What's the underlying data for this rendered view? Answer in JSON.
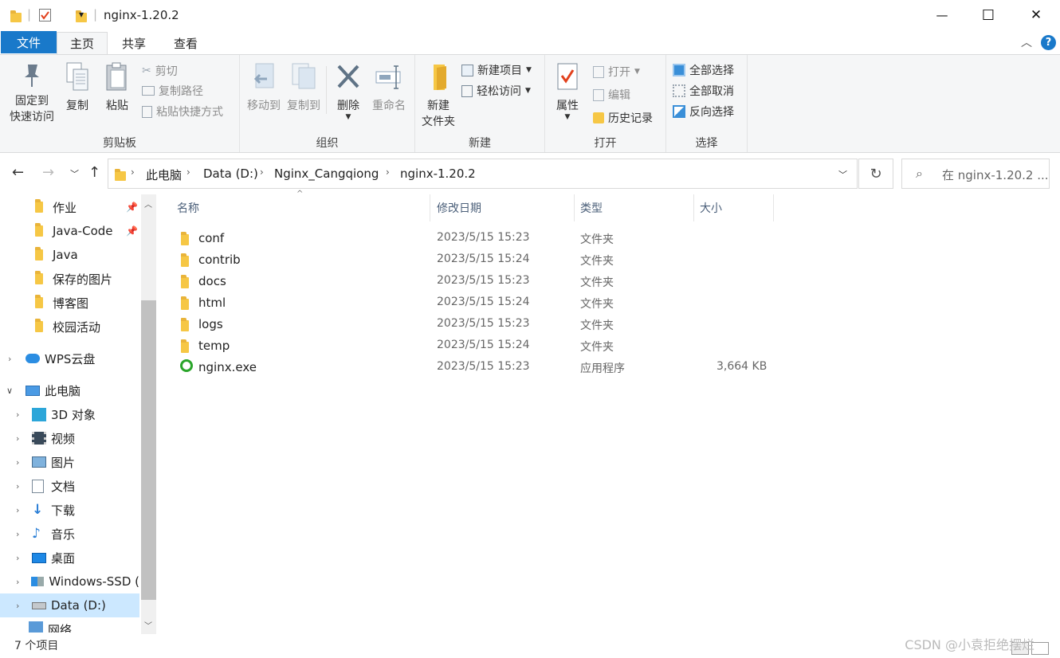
{
  "window": {
    "title": "nginx-1.20.2",
    "minimize": "—",
    "maximize": "☐",
    "close": "✕",
    "qat_dropdown": "▾"
  },
  "tabs": {
    "file": "文件",
    "home": "主页",
    "share": "共享",
    "view": "查看",
    "collapse": "︿",
    "help": "?"
  },
  "ribbon": {
    "clipboard": {
      "label": "剪贴板",
      "pin_quick": "固定到\n快速访问",
      "copy": "复制",
      "paste": "粘贴",
      "cut": "剪切",
      "copy_path": "复制路径",
      "paste_shortcut": "粘贴快捷方式"
    },
    "organize": {
      "label": "组织",
      "move_to": "移动到",
      "copy_to": "复制到",
      "delete": "删除",
      "rename": "重命名"
    },
    "new": {
      "label": "新建",
      "new_folder": "新建\n文件夹",
      "new_item": "新建项目",
      "easy_access": "轻松访问"
    },
    "open": {
      "label": "打开",
      "properties": "属性",
      "open": "打开",
      "edit": "编辑",
      "history": "历史记录"
    },
    "select": {
      "label": "选择",
      "select_all": "全部选择",
      "select_none": "全部取消",
      "invert": "反向选择"
    }
  },
  "address": {
    "crumbs": [
      "此电脑",
      "Data (D:)",
      "Nginx_Cangqiong",
      "nginx-1.20.2"
    ],
    "search_placeholder": "在 nginx-1.20.2 ..."
  },
  "nav": {
    "quick": [
      {
        "label": "作业",
        "pinned": true
      },
      {
        "label": "Java-Code",
        "pinned": true
      },
      {
        "label": "Java",
        "pinned": false
      },
      {
        "label": "保存的图片",
        "pinned": false
      },
      {
        "label": "博客图",
        "pinned": false
      },
      {
        "label": "校园活动",
        "pinned": false
      }
    ],
    "wps": "WPS云盘",
    "pc": "此电脑",
    "pc_items": [
      "3D 对象",
      "视频",
      "图片",
      "文档",
      "下载",
      "音乐",
      "桌面",
      "Windows-SSD (",
      "Data (D:)"
    ],
    "network": "网络"
  },
  "columns": {
    "name": "名称",
    "modified": "修改日期",
    "type": "类型",
    "size": "大小"
  },
  "files": [
    {
      "name": "conf",
      "modified": "2023/5/15 15:23",
      "type": "文件夹",
      "size": ""
    },
    {
      "name": "contrib",
      "modified": "2023/5/15 15:24",
      "type": "文件夹",
      "size": ""
    },
    {
      "name": "docs",
      "modified": "2023/5/15 15:23",
      "type": "文件夹",
      "size": ""
    },
    {
      "name": "html",
      "modified": "2023/5/15 15:24",
      "type": "文件夹",
      "size": ""
    },
    {
      "name": "logs",
      "modified": "2023/5/15 15:23",
      "type": "文件夹",
      "size": ""
    },
    {
      "name": "temp",
      "modified": "2023/5/15 15:24",
      "type": "文件夹",
      "size": ""
    },
    {
      "name": "nginx.exe",
      "modified": "2023/5/15 15:23",
      "type": "应用程序",
      "size": "3,664 KB"
    }
  ],
  "status": {
    "count": "7 个项目"
  },
  "watermark": "CSDN @小袁拒绝摆烂",
  "colors": {
    "accent": "#1979ca",
    "folder": "#f6c745",
    "selected": "#cce8ff"
  }
}
